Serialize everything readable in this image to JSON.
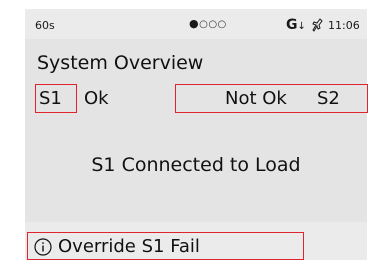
{
  "status_bar": {
    "mode": "60s",
    "page_indicator": {
      "active": "●",
      "inactive": "○○○"
    },
    "source_icon": "generator-icon",
    "source_letter": "G",
    "source_sub": "↓",
    "tool_icon": "wrench-icon",
    "time": "11:06"
  },
  "screen": {
    "title": "System Overview"
  },
  "sources": {
    "s1": {
      "label": "S1",
      "status": "Ok"
    },
    "s2": {
      "label": "S2",
      "status": "Not Ok"
    }
  },
  "main": {
    "message": "S1 Connected to Load"
  },
  "footer": {
    "icon": "info-icon",
    "alarm_text": "Override S1 Fail"
  },
  "colors": {
    "highlight_border": "#e0242f",
    "panel_background": "#e4e4e4",
    "bar_background": "#ebebeb",
    "text": "#111111"
  }
}
